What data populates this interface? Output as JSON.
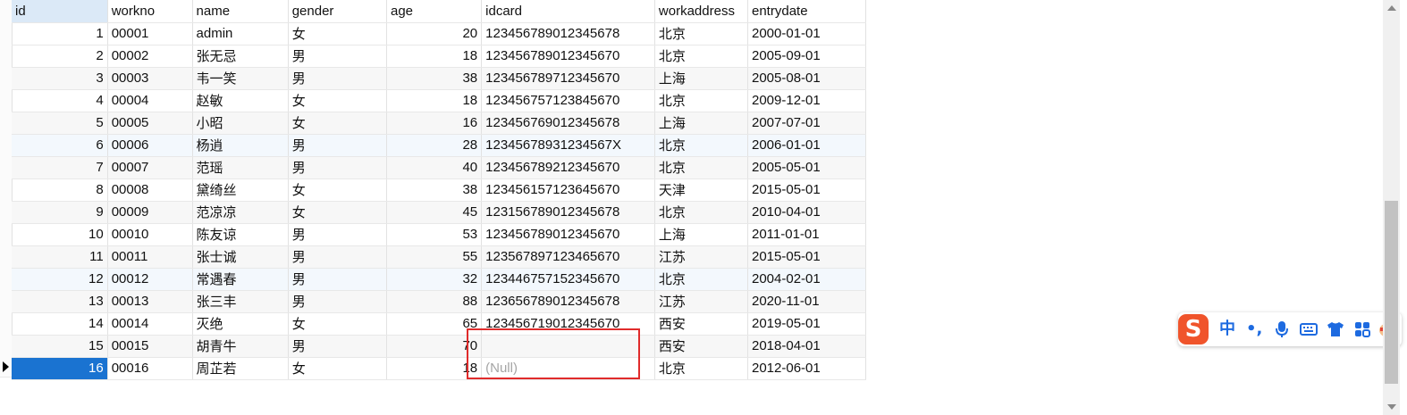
{
  "table": {
    "columns": [
      "id",
      "workno",
      "name",
      "gender",
      "age",
      "idcard",
      "workaddress",
      "entrydate"
    ],
    "rows": [
      [
        "1",
        "00001",
        "admin",
        "女",
        "20",
        "123456789012345678",
        "北京",
        "2000-01-01"
      ],
      [
        "2",
        "00002",
        "张无忌",
        "男",
        "18",
        "123456789012345670",
        "北京",
        "2005-09-01"
      ],
      [
        "3",
        "00003",
        "韦一笑",
        "男",
        "38",
        "123456789712345670",
        "上海",
        "2005-08-01"
      ],
      [
        "4",
        "00004",
        "赵敏",
        "女",
        "18",
        "123456757123845670",
        "北京",
        "2009-12-01"
      ],
      [
        "5",
        "00005",
        "小昭",
        "女",
        "16",
        "123456769012345678",
        "上海",
        "2007-07-01"
      ],
      [
        "6",
        "00006",
        "杨逍",
        "男",
        "28",
        "12345678931234567X",
        "北京",
        "2006-01-01"
      ],
      [
        "7",
        "00007",
        "范瑶",
        "男",
        "40",
        "123456789212345670",
        "北京",
        "2005-05-01"
      ],
      [
        "8",
        "00008",
        "黛绮丝",
        "女",
        "38",
        "123456157123645670",
        "天津",
        "2015-05-01"
      ],
      [
        "9",
        "00009",
        "范凉凉",
        "女",
        "45",
        "123156789012345678",
        "北京",
        "2010-04-01"
      ],
      [
        "10",
        "00010",
        "陈友谅",
        "男",
        "53",
        "123456789012345670",
        "上海",
        "2011-01-01"
      ],
      [
        "11",
        "00011",
        "张士诚",
        "男",
        "55",
        "123567897123465670",
        "江苏",
        "2015-05-01"
      ],
      [
        "12",
        "00012",
        "常遇春",
        "男",
        "32",
        "123446757152345670",
        "北京",
        "2004-02-01"
      ],
      [
        "13",
        "00013",
        "张三丰",
        "男",
        "88",
        "123656789012345678",
        "江苏",
        "2020-11-01"
      ],
      [
        "14",
        "00014",
        "灭绝",
        "女",
        "65",
        "123456719012345670",
        "西安",
        "2019-05-01"
      ],
      [
        "15",
        "00015",
        "胡青牛",
        "男",
        "70",
        "",
        "西安",
        "2018-04-01"
      ],
      [
        "16",
        "00016",
        "周芷若",
        "女",
        "18",
        "(Null)",
        "北京",
        "2012-06-01"
      ]
    ],
    "selected_row": 16,
    "highlighted_cell_note_color": "#e02b2b"
  },
  "ime_toolbar": {
    "logo": "S",
    "mode_label": "中",
    "punct_label": "•,",
    "icons": [
      "microphone-icon",
      "keyboard-icon",
      "shirt-icon",
      "grid-icon",
      "mascot-icon"
    ]
  },
  "colors": {
    "selected_id_bg": "#1a73d1",
    "header_id_bg": "#dbe9f7",
    "ime_logo": "#f0542b",
    "ime_icon": "#1d6ae0"
  }
}
